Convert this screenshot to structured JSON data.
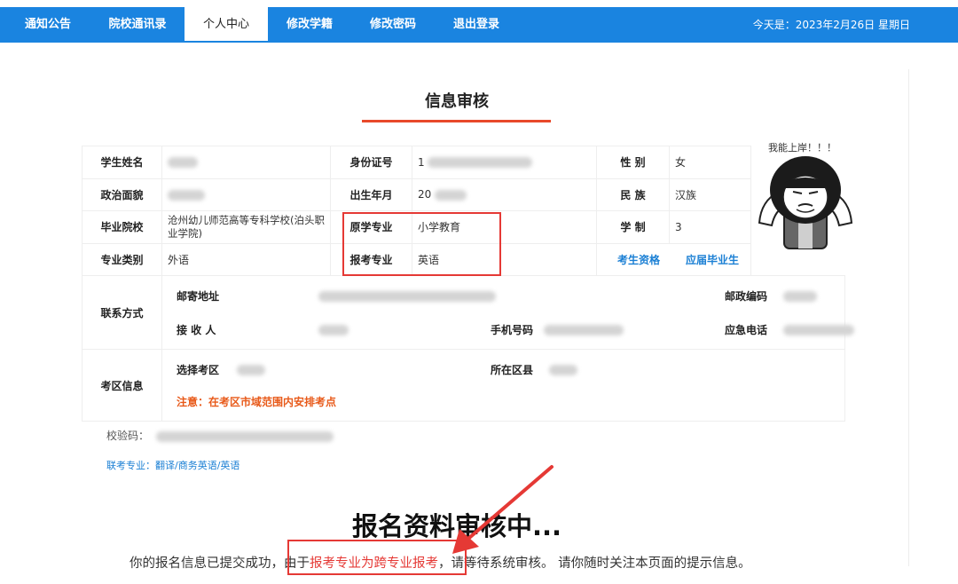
{
  "nav": {
    "items": [
      {
        "label": "通知公告"
      },
      {
        "label": "院校通讯录"
      },
      {
        "label": "个人中心"
      },
      {
        "label": "修改学籍"
      },
      {
        "label": "修改密码"
      },
      {
        "label": "退出登录"
      }
    ],
    "today": "今天是：2023年2月26日 星期日"
  },
  "page_title": "信息审核",
  "table": {
    "name_label": "学生姓名",
    "id_label": "身份证号",
    "id_value_prefix": "1",
    "gender_label": "性 别",
    "gender_value": "女",
    "politics_label": "政治面貌",
    "birth_label": "出生年月",
    "birth_value_prefix": "20",
    "ethnic_label": "民 族",
    "ethnic_value": "汉族",
    "school_label": "毕业院校",
    "school_value": "沧州幼儿师范高等专科学校(泊头职业学院)",
    "orig_major_label": "原学专业",
    "orig_major_value": "小学教育",
    "duration_label": "学 制",
    "duration_value": "3",
    "category_label": "专业类别",
    "category_value": "外语",
    "apply_major_label": "报考专业",
    "apply_major_value": "英语",
    "qualification_label": "考生资格",
    "qualification_value": "应届毕业生",
    "contact_label": "联系方式",
    "address_label": "邮寄地址",
    "postcode_label": "邮政编码",
    "receiver_label": "接 收 人",
    "phone_label": "手机号码",
    "emergency_label": "应急电话",
    "exam_area_label": "考区信息",
    "select_area_label": "选择考区",
    "district_label": "所在区县",
    "note": "注意：在考区市域范围内安排考点"
  },
  "check_code_label": "校验码：",
  "joint_majors": "联考专业：翻译/商务英语/英语",
  "sticker_text": "我能上岸！！！",
  "status": {
    "heading": "报名资料审核中...",
    "msg_prefix": "你的报名信息已提交成功，",
    "msg_highlight_a": "由于",
    "msg_highlight_b": "报考专业为跨专业报考",
    "msg_highlight_c": "，",
    "msg_suffix": "请等待系统审核。 请你随时关注本页面的提示信息。"
  },
  "colors": {
    "nav_bg": "#1a84e0",
    "accent_red": "#e53935",
    "title_underline": "#e8492a",
    "link_blue": "#1a7fd4",
    "note_orange": "#e85a1a"
  }
}
